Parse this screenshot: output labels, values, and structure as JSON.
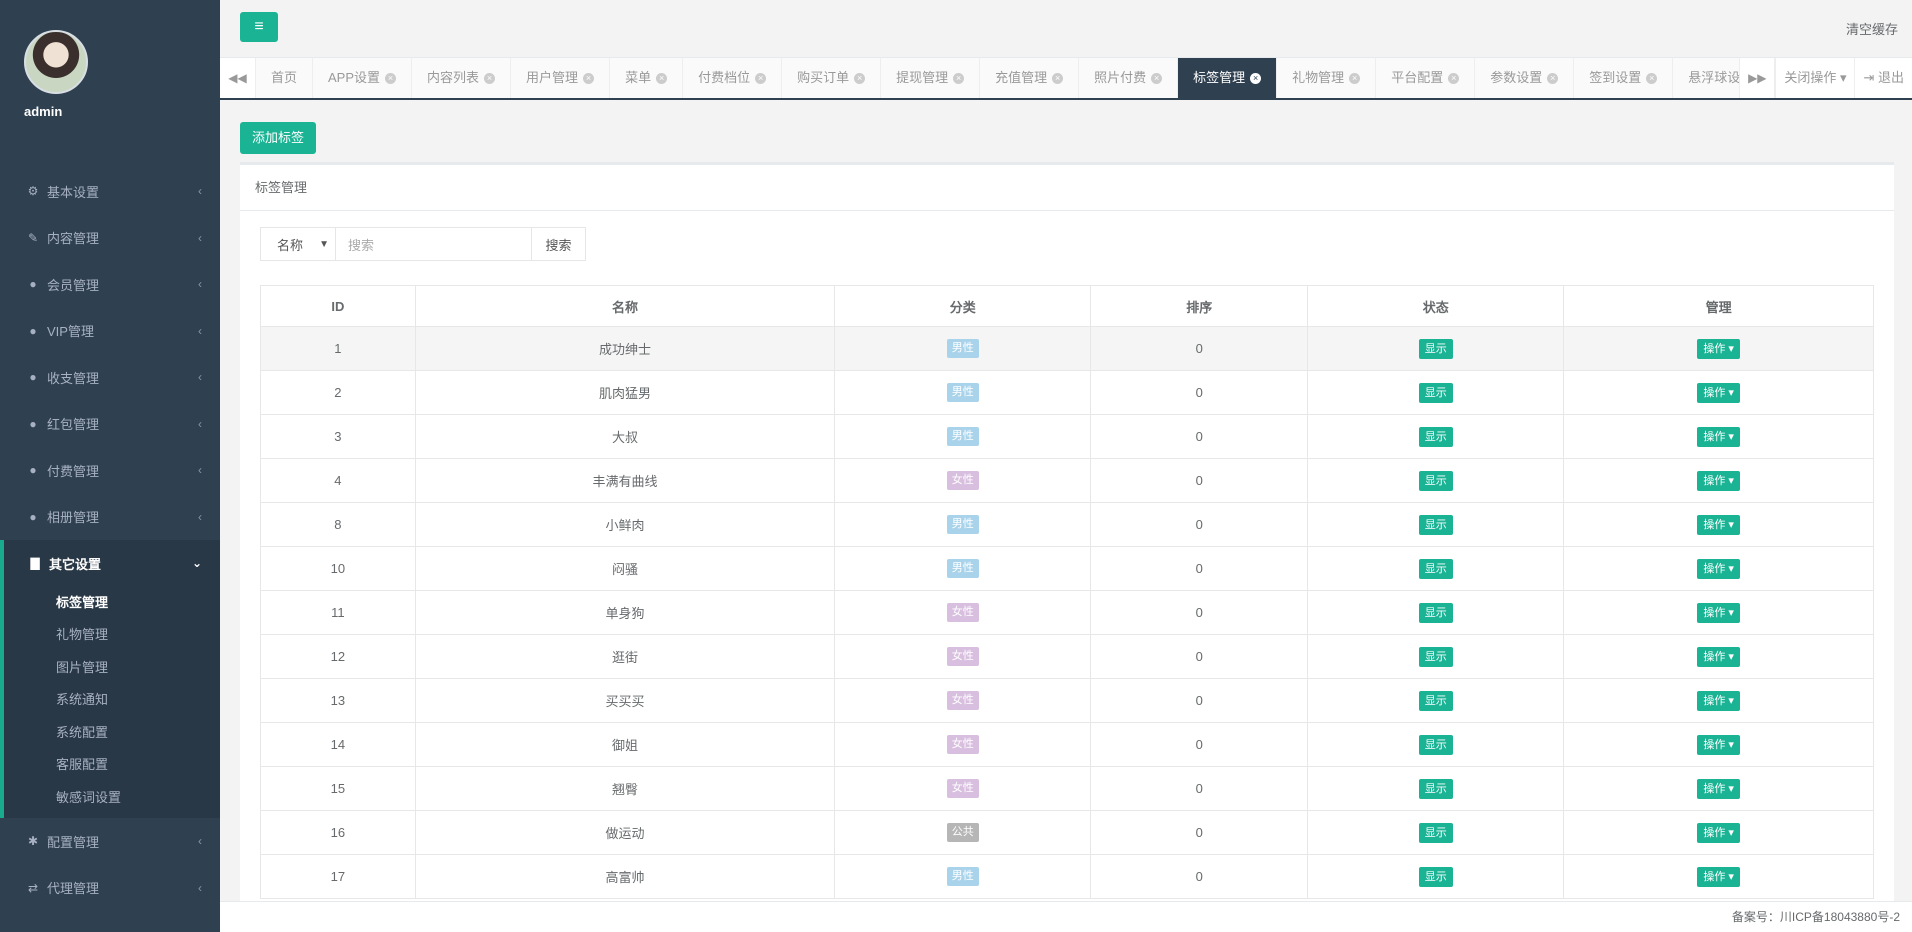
{
  "user": {
    "name": "admin"
  },
  "topbar": {
    "clear_cache": "清空缓存"
  },
  "nav": [
    {
      "label": "基本设置",
      "icon": "⚙"
    },
    {
      "label": "内容管理",
      "icon": "✎"
    },
    {
      "label": "会员管理",
      "icon": "●"
    },
    {
      "label": "VIP管理",
      "icon": "●"
    },
    {
      "label": "收支管理",
      "icon": "●"
    },
    {
      "label": "红包管理",
      "icon": "●"
    },
    {
      "label": "付费管理",
      "icon": "●"
    },
    {
      "label": "相册管理",
      "icon": "●"
    }
  ],
  "nav_open": {
    "label": "其它设置",
    "items": [
      "标签管理",
      "礼物管理",
      "图片管理",
      "系统通知",
      "系统配置",
      "客服配置",
      "敏感词设置"
    ]
  },
  "nav_bottom": [
    {
      "label": "配置管理",
      "icon": "✱"
    },
    {
      "label": "代理管理",
      "icon": "⇄"
    }
  ],
  "tabs": [
    "首页",
    "APP设置",
    "内容列表",
    "用户管理",
    "菜单",
    "付费档位",
    "购买订单",
    "提现管理",
    "充值管理",
    "照片付费",
    "标签管理",
    "礼物管理",
    "平台配置",
    "参数设置",
    "签到设置",
    "悬浮球设置"
  ],
  "tab_actions": {
    "close_ops": "关闭操作",
    "logout": "退出"
  },
  "page": {
    "add_button": "添加标签",
    "panel_title": "标签管理",
    "search": {
      "field_option": "名称",
      "placeholder": "搜索",
      "button": "搜索"
    }
  },
  "table": {
    "headers": [
      "ID",
      "名称",
      "分类",
      "排序",
      "状态",
      "管理"
    ],
    "rows": [
      {
        "id": "1",
        "name": "成功绅士",
        "category": "男性",
        "sort": "0",
        "status": "显示",
        "op": "操作"
      },
      {
        "id": "2",
        "name": "肌肉猛男",
        "category": "男性",
        "sort": "0",
        "status": "显示",
        "op": "操作"
      },
      {
        "id": "3",
        "name": "大叔",
        "category": "男性",
        "sort": "0",
        "status": "显示",
        "op": "操作"
      },
      {
        "id": "4",
        "name": "丰满有曲线",
        "category": "女性",
        "sort": "0",
        "status": "显示",
        "op": "操作"
      },
      {
        "id": "8",
        "name": "小鲜肉",
        "category": "男性",
        "sort": "0",
        "status": "显示",
        "op": "操作"
      },
      {
        "id": "10",
        "name": "闷骚",
        "category": "男性",
        "sort": "0",
        "status": "显示",
        "op": "操作"
      },
      {
        "id": "11",
        "name": "单身狗",
        "category": "女性",
        "sort": "0",
        "status": "显示",
        "op": "操作"
      },
      {
        "id": "12",
        "name": "逛街",
        "category": "女性",
        "sort": "0",
        "status": "显示",
        "op": "操作"
      },
      {
        "id": "13",
        "name": "买买买",
        "category": "女性",
        "sort": "0",
        "status": "显示",
        "op": "操作"
      },
      {
        "id": "14",
        "name": "御姐",
        "category": "女性",
        "sort": "0",
        "status": "显示",
        "op": "操作"
      },
      {
        "id": "15",
        "name": "翘臀",
        "category": "女性",
        "sort": "0",
        "status": "显示",
        "op": "操作"
      },
      {
        "id": "16",
        "name": "做运动",
        "category": "公共",
        "sort": "0",
        "status": "显示",
        "op": "操作"
      },
      {
        "id": "17",
        "name": "高富帅",
        "category": "男性",
        "sort": "0",
        "status": "显示",
        "op": "操作"
      }
    ]
  },
  "footer": {
    "icp": "备案号：川ICP备18043880号-2"
  },
  "colors": {
    "sidebar": "#2f4050",
    "accent": "#1ab394",
    "male": "#a9d3ea",
    "female": "#d8bfdf",
    "public": "#b6b6b6"
  }
}
